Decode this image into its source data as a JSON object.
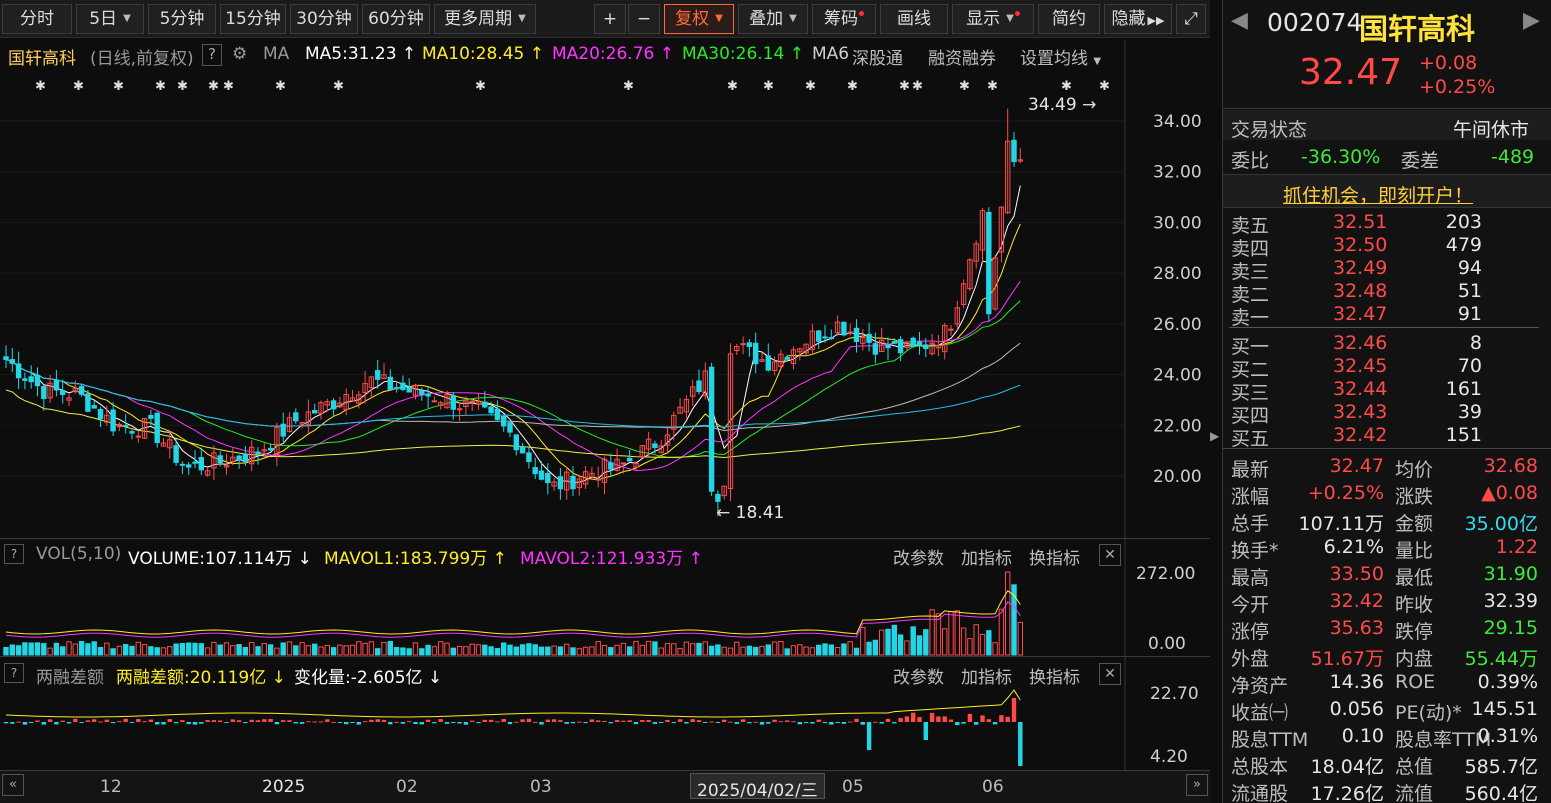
{
  "toolbar": {
    "periods": [
      "分时",
      "5日",
      "5分钟",
      "15分钟",
      "30分钟",
      "60分钟",
      "更多周期"
    ],
    "plus_label": "+",
    "minus_label": "−",
    "fuquan_label": "复权",
    "overlay_label": "叠加",
    "chips_label": "筹码",
    "draw_label": "画线",
    "display_label": "显示",
    "simple_label": "简约",
    "hide_label": "隐藏"
  },
  "chart_header": {
    "stock_name": "国轩高科",
    "mode": "(日线,前复权)",
    "help": "?",
    "ma_label": "MA",
    "ma5": "MA5:31.23",
    "ma10": "MA10:28.45",
    "ma20": "MA20:26.76",
    "ma30": "MA30:26.14",
    "ma60": "MA6",
    "hk_connect": "深股通",
    "margin": "融资融券",
    "set_ma": "设置均线"
  },
  "price_axis": [
    "34.00",
    "32.00",
    "30.00",
    "28.00",
    "26.00",
    "24.00",
    "22.00",
    "20.00"
  ],
  "annotations": {
    "high": "34.49",
    "low": "18.41"
  },
  "volume_panel": {
    "name": "VOL(5,10)",
    "volume": "VOLUME:107.114万",
    "mavol1": "MAVOL1:183.799万",
    "mavol2": "MAVOL2:121.933万",
    "axis_top": "272.00",
    "axis_bottom": "0.00",
    "actions": [
      "改参数",
      "加指标",
      "换指标"
    ]
  },
  "margin_panel": {
    "name": "两融差额",
    "value": "两融差额:20.119亿",
    "change": "变化量:-2.605亿",
    "axis_top": "22.70",
    "axis_bottom": "4.20",
    "actions": [
      "改参数",
      "加指标",
      "换指标"
    ]
  },
  "time_axis": [
    "12",
    "2025",
    "02",
    "03",
    "2025/04/02/三",
    "05",
    "06"
  ],
  "quote": {
    "code": "002074",
    "name": "国轩高科",
    "price": "32.47",
    "change": "+0.08",
    "change_pct": "+0.25%",
    "status_label": "交易状态",
    "status_value": "午间休市",
    "weibi_label": "委比",
    "weibi_value": "-36.30%",
    "weicha_label": "委差",
    "weicha_value": "-489",
    "promo": "抓住机会，即刻开户！"
  },
  "order_book": {
    "asks": [
      {
        "label": "卖五",
        "price": "32.51",
        "volume": "203"
      },
      {
        "label": "卖四",
        "price": "32.50",
        "volume": "479"
      },
      {
        "label": "卖三",
        "price": "32.49",
        "volume": "94"
      },
      {
        "label": "卖二",
        "price": "32.48",
        "volume": "51"
      },
      {
        "label": "卖一",
        "price": "32.47",
        "volume": "91"
      }
    ],
    "bids": [
      {
        "label": "买一",
        "price": "32.46",
        "volume": "8"
      },
      {
        "label": "买二",
        "price": "32.45",
        "volume": "70"
      },
      {
        "label": "买三",
        "price": "32.44",
        "volume": "161"
      },
      {
        "label": "买四",
        "price": "32.43",
        "volume": "39"
      },
      {
        "label": "买五",
        "price": "32.42",
        "volume": "151"
      }
    ]
  },
  "stats": [
    {
      "l1": "最新",
      "v1": "32.47",
      "c1": "red",
      "l2": "均价",
      "v2": "32.68",
      "c2": "red"
    },
    {
      "l1": "涨幅",
      "v1": "+0.25%",
      "c1": "red",
      "l2": "涨跌",
      "v2": "▲0.08",
      "c2": "red"
    },
    {
      "l1": "总手",
      "v1": "107.11万",
      "c1": "white",
      "l2": "金额",
      "v2": "35.00亿",
      "c2": "cyan"
    },
    {
      "l1": "换手*",
      "v1": "6.21%",
      "c1": "white",
      "l2": "量比",
      "v2": "1.22",
      "c2": "red"
    },
    {
      "l1": "最高",
      "v1": "33.50",
      "c1": "red",
      "l2": "最低",
      "v2": "31.90",
      "c2": "green"
    },
    {
      "l1": "今开",
      "v1": "32.42",
      "c1": "red",
      "l2": "昨收",
      "v2": "32.39",
      "c2": "white"
    },
    {
      "l1": "涨停",
      "v1": "35.63",
      "c1": "red",
      "l2": "跌停",
      "v2": "29.15",
      "c2": "green"
    },
    {
      "l1": "外盘",
      "v1": "51.67万",
      "c1": "red",
      "l2": "内盘",
      "v2": "55.44万",
      "c2": "green"
    },
    {
      "l1": "净资产",
      "v1": "14.36",
      "c1": "white",
      "l2": "ROE",
      "v2": "0.39%",
      "c2": "white"
    },
    {
      "l1": "收益㈠",
      "v1": "0.056",
      "c1": "white",
      "l2": "PE(动)*",
      "v2": "145.51",
      "c2": "white"
    },
    {
      "l1": "股息TTM",
      "v1": "0.10",
      "c1": "white",
      "l2": "股息率TTM",
      "v2": "0.31%",
      "c2": "white"
    },
    {
      "l1": "总股本",
      "v1": "18.04亿",
      "c1": "white",
      "l2": "总值",
      "v2": "585.7亿",
      "c2": "white"
    },
    {
      "l1": "流通股",
      "v1": "17.26亿",
      "c1": "white",
      "l2": "流值",
      "v2": "560.4亿",
      "c2": "white"
    }
  ],
  "colors": {
    "up": "#ff4a4a",
    "down": "#22d6e6",
    "ma5": "#ffffff",
    "ma10": "#ffee22",
    "ma20": "#ff33ff",
    "ma30": "#22ee22"
  },
  "chart_data": {
    "type": "candlestick",
    "title": "国轩高科 (日线,前复权)",
    "ylim": [
      18,
      35
    ],
    "x_ticks": [
      "12",
      "2025",
      "02",
      "03",
      "2025/04/02/三",
      "05",
      "06"
    ],
    "close_samples": [
      24.6,
      23.4,
      23.2,
      22.0,
      21.9,
      20.3,
      20.6,
      21.0,
      22.2,
      22.9,
      23.8,
      23.4,
      23.1,
      22.6,
      21.6,
      19.5,
      20.1,
      20.4,
      21.4,
      23.3,
      25.2,
      24.5,
      25.3,
      26.0,
      25.2,
      24.9,
      25.7,
      30.6,
      32.47
    ],
    "high": 34.49,
    "low": 18.41,
    "volume_ylim": [
      0,
      272
    ],
    "margin_ylim": [
      4.2,
      22.7
    ]
  }
}
